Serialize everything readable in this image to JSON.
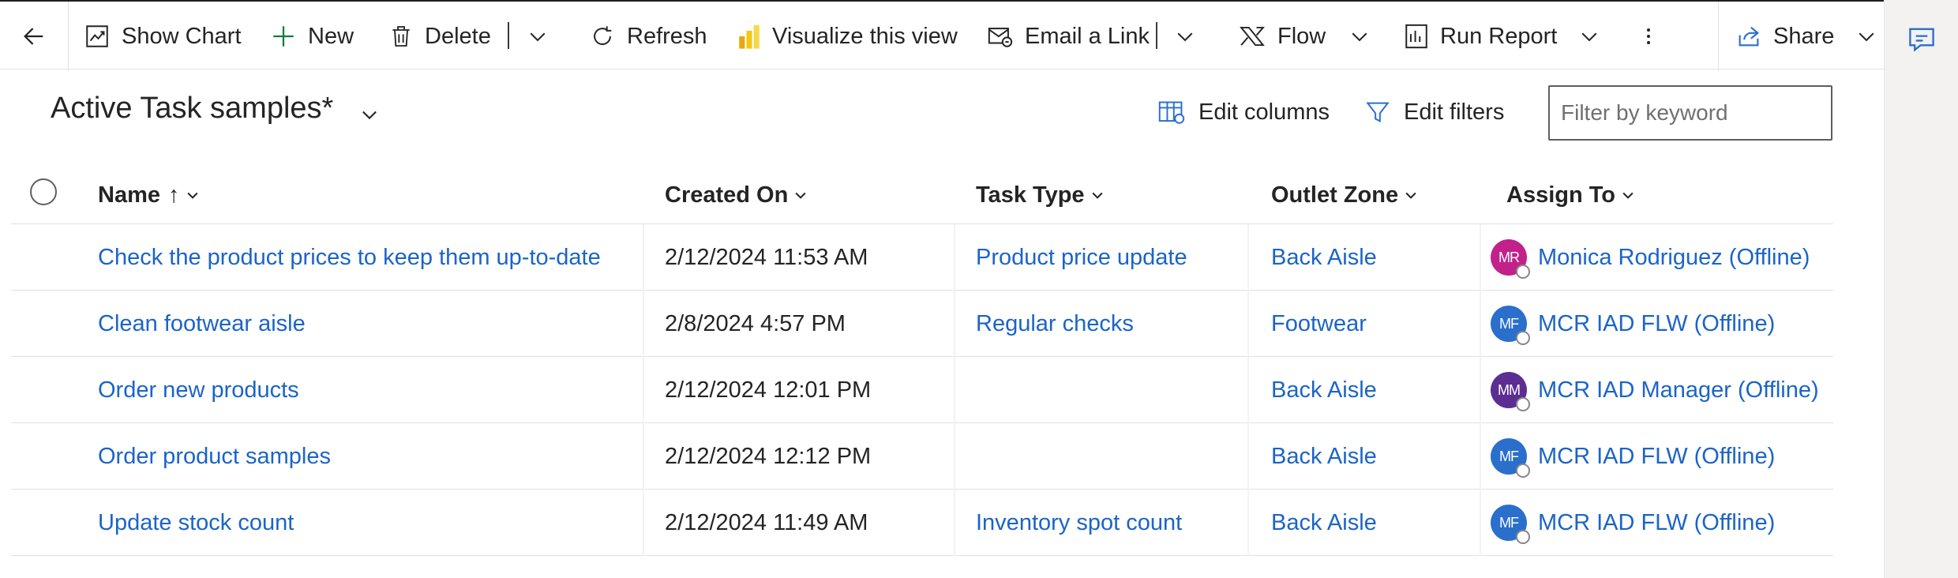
{
  "commandbar": {
    "show_chart": "Show Chart",
    "new": "New",
    "delete": "Delete",
    "refresh": "Refresh",
    "visualize": "Visualize this view",
    "email_link": "Email a Link",
    "flow": "Flow",
    "run_report": "Run Report",
    "share": "Share"
  },
  "view": {
    "title": "Active Task samples*",
    "edit_columns": "Edit columns",
    "edit_filters": "Edit filters",
    "filter_placeholder": "Filter by keyword"
  },
  "grid": {
    "columns": [
      "Name",
      "Created On",
      "Task Type",
      "Outlet Zone",
      "Assign To"
    ],
    "sort_indicator": "↑",
    "rows": [
      {
        "name": "Check the product prices to keep them up-to-date",
        "created_on": "2/12/2024 11:53 AM",
        "task_type": "Product price update",
        "outlet_zone": "Back Aisle",
        "assign_initials": "MR",
        "assign_color": "#c2218a",
        "assign_to": "Monica Rodriguez (Offline)"
      },
      {
        "name": "Clean footwear aisle",
        "created_on": "2/8/2024 4:57 PM",
        "task_type": "Regular checks",
        "outlet_zone": "Footwear",
        "assign_initials": "MF",
        "assign_color": "#2a6fcb",
        "assign_to": "MCR IAD FLW (Offline)"
      },
      {
        "name": "Order new products",
        "created_on": "2/12/2024 12:01 PM",
        "task_type": "",
        "outlet_zone": "Back Aisle",
        "assign_initials": "MM",
        "assign_color": "#5c2e91",
        "assign_to": "MCR IAD Manager (Offline)"
      },
      {
        "name": "Order product samples",
        "created_on": "2/12/2024 12:12 PM",
        "task_type": "",
        "outlet_zone": "Back Aisle",
        "assign_initials": "MF",
        "assign_color": "#2a6fcb",
        "assign_to": "MCR IAD FLW (Offline)"
      },
      {
        "name": "Update stock count",
        "created_on": "2/12/2024 11:49 AM",
        "task_type": "Inventory spot count",
        "outlet_zone": "Back Aisle",
        "assign_initials": "MF",
        "assign_color": "#2a6fcb",
        "assign_to": "MCR IAD FLW (Offline)"
      }
    ]
  },
  "icons": {
    "back": "back-arrow-icon",
    "chart": "chart-icon",
    "new": "plus-icon",
    "delete": "trash-icon",
    "refresh": "refresh-icon",
    "visualize": "power-bi-icon",
    "email": "email-link-icon",
    "flow": "flow-icon",
    "report": "report-icon",
    "more": "more-vertical-icon",
    "share": "share-icon",
    "chat": "chat-icon",
    "columns": "edit-columns-icon",
    "filter": "filter-icon"
  },
  "colors": {
    "link": "#1b64c8",
    "accent": "#0f6cbd",
    "powerbi": "#f2c811"
  }
}
